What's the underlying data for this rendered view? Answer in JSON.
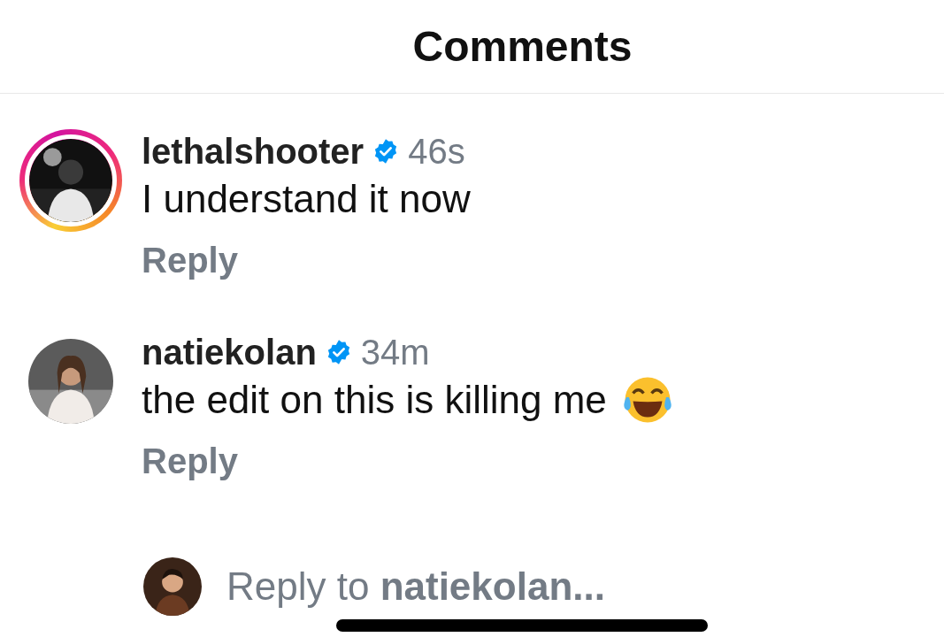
{
  "header": {
    "title": "Comments"
  },
  "comments": [
    {
      "username": "lethalshooter",
      "verified": true,
      "time": "46s",
      "text": "I understand it now",
      "story_ring": true,
      "reply": "Reply"
    },
    {
      "username": "natiekolan",
      "verified": true,
      "time": "34m",
      "text": "the edit on this is killing me",
      "has_emoji": true,
      "story_ring": false,
      "reply": "Reply"
    }
  ],
  "reply_field": {
    "prefix": "Reply to ",
    "target": "natiekolan..."
  }
}
